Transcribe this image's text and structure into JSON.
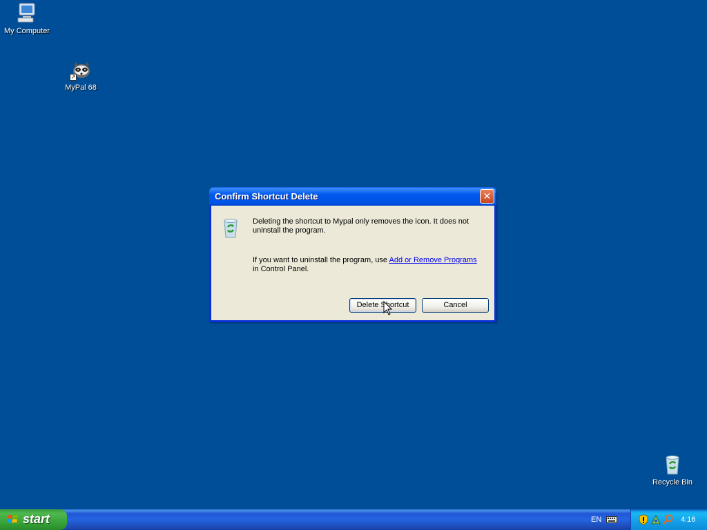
{
  "desktop": {
    "icons": [
      {
        "label": "My Computer",
        "icon": "my-computer-icon"
      },
      {
        "label": "MyPal 68",
        "icon": "mypal-icon"
      },
      {
        "label": "Recycle Bin",
        "icon": "recycle-bin-icon"
      }
    ],
    "background_color": "#004E98"
  },
  "dialog": {
    "title": "Confirm Shortcut Delete",
    "close_label": "✕",
    "message_line1": "Deleting the shortcut to Mypal only removes the icon. It does not uninstall the program.",
    "message_line2_prefix": "If you want to uninstall the program, use ",
    "message_link": "Add or Remove Programs",
    "message_line2_suffix": " in Control Panel.",
    "delete_button": "Delete Shortcut",
    "cancel_button": "Cancel",
    "icon": "recycle-bin-icon"
  },
  "taskbar": {
    "start_label": "start",
    "language": "EN",
    "clock": "4:16",
    "tray_icons": [
      "security-shield-icon",
      "network-icon",
      "search-icon"
    ]
  }
}
